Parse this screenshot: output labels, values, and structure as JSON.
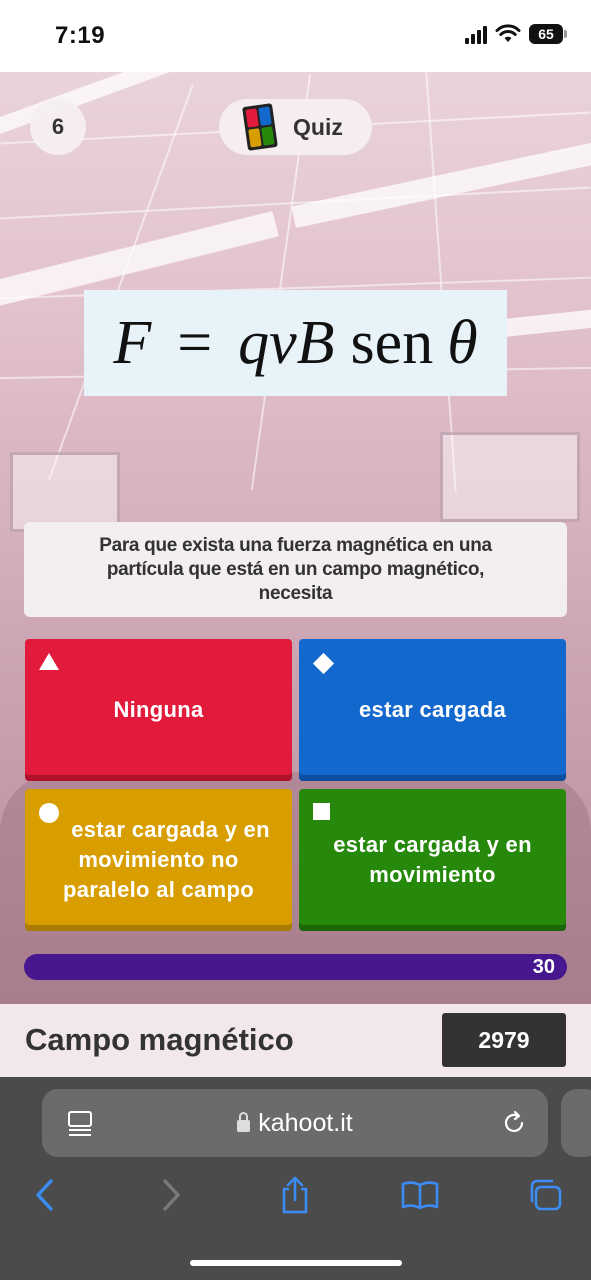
{
  "status_bar": {
    "time": "7:19",
    "battery": "65"
  },
  "header": {
    "question_number": "6",
    "quiz_label": "Quiz"
  },
  "formula": {
    "lhs": "F",
    "eq": "=",
    "rhs": "qvB",
    "func": "sen",
    "angle": "θ"
  },
  "question": {
    "text": "Para que exista una fuerza magnética en una partícula que está en un campo magnético, necesita"
  },
  "answers": [
    {
      "label": "Ninguna",
      "shape": "triangle",
      "color": "#e21b3c"
    },
    {
      "label": "estar cargada",
      "shape": "diamond",
      "color": "#1368ce"
    },
    {
      "label": "estar cargada y en movimiento no paralelo al campo",
      "shape": "circle",
      "color": "#d89e00"
    },
    {
      "label": "estar cargada y en movimiento",
      "shape": "square",
      "color": "#26890c"
    }
  ],
  "timer": {
    "seconds": "30",
    "color": "#46178f"
  },
  "footer": {
    "player_name": "Campo magnético",
    "score": "2979"
  },
  "browser": {
    "url": "kahoot.it",
    "reader_icon": "reader-icon",
    "reload_icon": "reload-icon",
    "toolbar": [
      "back-icon",
      "forward-icon",
      "share-icon",
      "bookmarks-icon",
      "tabs-icon"
    ]
  }
}
